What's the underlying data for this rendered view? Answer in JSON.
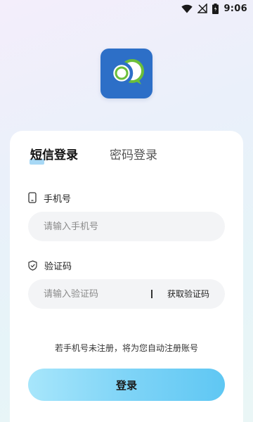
{
  "status_bar": {
    "time": "9:06",
    "icons": [
      "wifi-icon",
      "no-signal-icon",
      "battery-icon"
    ]
  },
  "app": {
    "logo_icon": "chat-bubbles-icon",
    "logo_color": "#2d6fc7"
  },
  "tabs": [
    {
      "label": "短信登录",
      "active": true
    },
    {
      "label": "密码登录",
      "active": false
    }
  ],
  "phone": {
    "label": "手机号",
    "icon": "phone-icon",
    "placeholder": "请输入手机号",
    "value": ""
  },
  "code": {
    "label": "验证码",
    "icon": "shield-icon",
    "placeholder": "请输入验证码",
    "value": "",
    "get_code_label": "获取验证码"
  },
  "notice": "若手机号未注册，将为您自动注册账号",
  "login_button": "登录",
  "colors": {
    "accent_start": "#a7e6fb",
    "accent_end": "#5fc7f3",
    "tab_underline": "#a7d8f5"
  }
}
